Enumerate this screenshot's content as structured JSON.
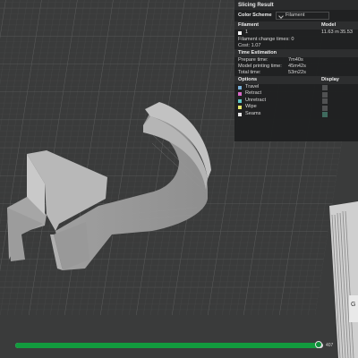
{
  "panel": {
    "title": "Slicing Result",
    "color_scheme_label": "Color Scheme",
    "color_scheme_value": "Filament",
    "filament_header": "Filament",
    "model_header": "Model",
    "filament_number": "1",
    "filament_color": "#ffffff",
    "filament_length": "11.63 m",
    "filament_weight": "35.53",
    "filament_change_times": "Filament change times:  0",
    "cost": "Cost:  1.07",
    "time_estimation_header": "Time Estimation",
    "prepare_time_label": "Prepare time:",
    "prepare_time_value": "7m40s",
    "model_printing_time_label": "Model printing time:",
    "model_printing_time_value": "45m42s",
    "total_time_label": "Total time:",
    "total_time_value": "53m22s",
    "options_header": "Options",
    "display_header": "Display",
    "options": [
      {
        "label": "Travel",
        "color": "#7ab0d8",
        "display": false
      },
      {
        "label": "Retract",
        "color": "#d86ac8",
        "display": false
      },
      {
        "label": "Unretract",
        "color": "#5fc8c8",
        "display": false
      },
      {
        "label": "Wipe",
        "color": "#e8e86a",
        "display": false
      },
      {
        "label": "Seams",
        "color": "#e8e8e8",
        "display": true
      }
    ]
  },
  "layer_slider": {
    "progress": 0.985,
    "layer_label": "407"
  },
  "colors": {
    "accent": "#129b3e",
    "bed": "#3a3b3b",
    "model": "#a9a9a9"
  }
}
